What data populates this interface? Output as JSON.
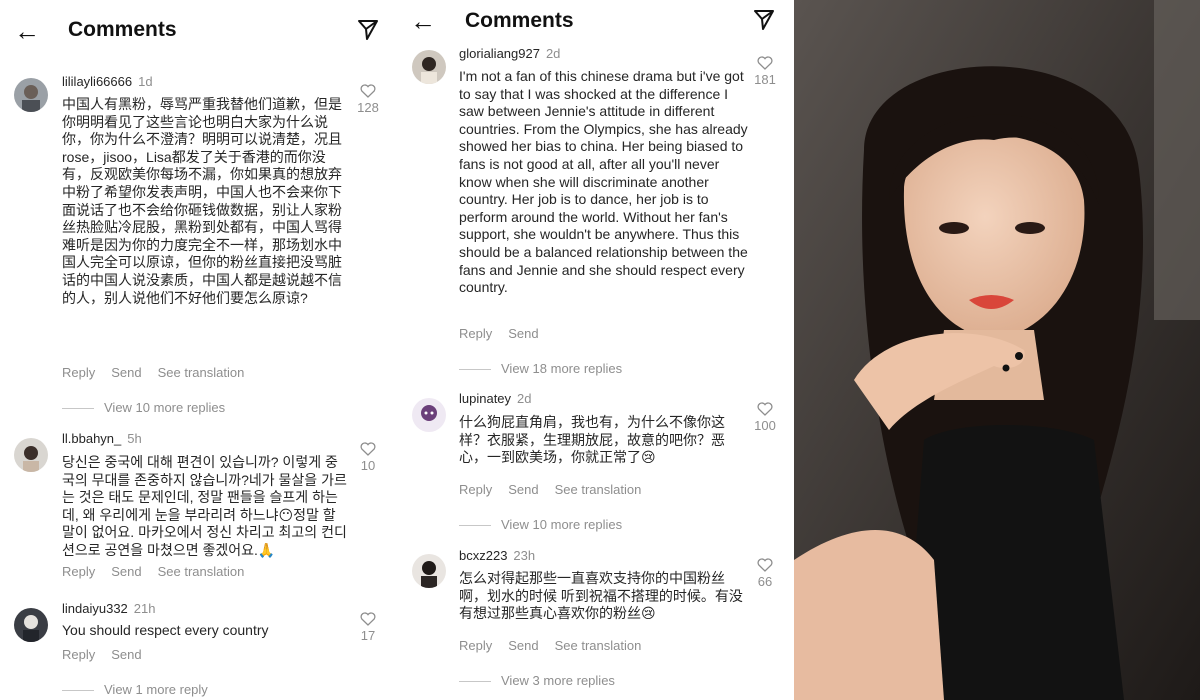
{
  "colors": {
    "text": "#262626",
    "muted": "#8e8e8e",
    "divider": "#c7c7c7"
  },
  "icons": {
    "back": "arrow-left-icon",
    "send": "paper-plane-icon",
    "like": "heart-outline-icon"
  },
  "left": {
    "header": {
      "back_glyph": "←",
      "title": "Comments"
    },
    "comments": [
      {
        "username": "lililayli66666",
        "age": "1d",
        "likes": "128",
        "text": "中国人有黑粉，辱骂严重我替他们道歉，但是你明明看见了这些言论也明白大家为什么说你，你为什么不澄清？明明可以说清楚，况且rose，jisoo，Lisa都发了关于香港的而你没有，反观欧美你每场不漏，你如果真的想放弃中粉了希望你发表声明，中国人也不会来你下面说话了也不会给你砸钱做数据，别让人家粉丝热脸贴冷屁股，黑粉到处都有，中国人骂得难听是因为你的力度完全不一样，那场划水中国人完全可以原谅，但你的粉丝直接把没骂脏话的中国人说没素质，中国人都是越说越不信的人，别人说他们不好他们要怎么原谅?",
        "reply": "Reply",
        "send": "Send",
        "translate": "See translation",
        "view_more": "View 10 more replies"
      },
      {
        "username": "ll.bbahyn_",
        "age": "5h",
        "likes": "10",
        "text": "당신은 중국에 대해 편견이 있습니까? 이렇게 중국의 무대를 존중하지 않습니까?네가 물살을 가르는 것은 태도 문제인데, 정말 팬들을 슬프게 하는데, 왜 우리에게 눈을 부라리려 하느냐😶정말 할 말이 없어요. 마카오에서 정신 차리고 최고의 컨디션으로 공연을 마쳤으면 좋겠어요.🙏",
        "reply": "Reply",
        "send": "Send",
        "translate": "See translation"
      },
      {
        "username": "lindaiyu332",
        "age": "21h",
        "likes": "17",
        "text": "You should respect every country",
        "reply": "Reply",
        "send": "Send",
        "view_more": "View 1 more reply"
      }
    ]
  },
  "middle": {
    "header": {
      "back_glyph": "←",
      "title": "Comments"
    },
    "comments": [
      {
        "username": "glorialiang927",
        "age": "2d",
        "likes": "181",
        "text": "I'm not a fan of this chinese drama but i've got to say that I was shocked at the difference I saw between Jennie's attitude in different countries. From the Olympics, she has already showed her bias to china. Her being biased to fans is not good at all, after all you'll never know when she will discriminate another country. Her job is to dance, her job is to perform around the world. Without her fan's support, she wouldn't be anywhere. Thus this should be a balanced relationship between the fans and Jennie and she should respect every country.",
        "reply": "Reply",
        "send": "Send",
        "view_more": "View 18 more replies"
      },
      {
        "username": "lupinatey",
        "age": "2d",
        "likes": "100",
        "text": "什么狗屁直角肩，我也有，为什么不像你这样？衣服紧，生理期放屁，故意的吧你？恶心，一到欧美场，你就正常了😢",
        "reply": "Reply",
        "send": "Send",
        "translate": "See translation",
        "view_more": "View 10 more replies"
      },
      {
        "username": "bcxz223",
        "age": "23h",
        "likes": "66",
        "text": "怎么对得起那些一直喜欢支持你的中国粉丝啊，划水的时候 听到祝福不搭理的时候。有没有想过那些真心喜欢你的粉丝😢",
        "reply": "Reply",
        "send": "Send",
        "translate": "See translation",
        "view_more": "View 3 more replies"
      }
    ]
  }
}
